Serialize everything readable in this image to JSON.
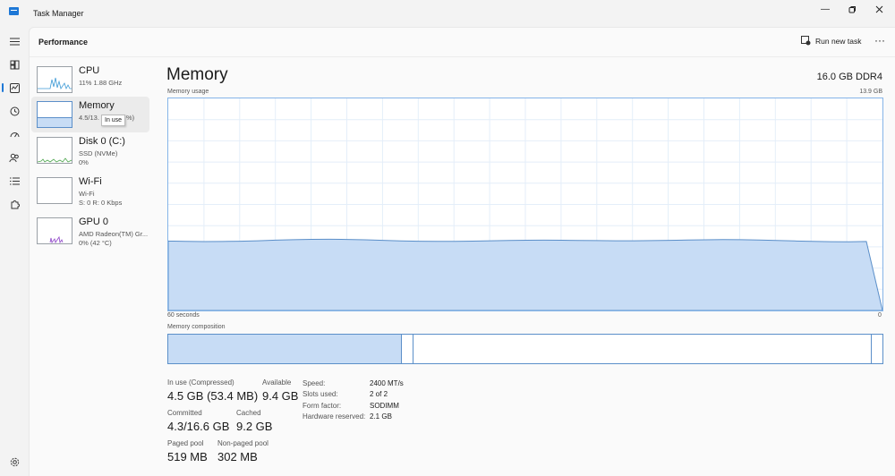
{
  "window": {
    "title": "Task Manager",
    "controls": [
      "minimize-icon",
      "restore-icon",
      "close-icon"
    ]
  },
  "header": {
    "title": "Performance",
    "run_new_task": "Run new task",
    "more": "···"
  },
  "sidebar": [
    {
      "name": "CPU",
      "sub1": "11%  1.88 GHz",
      "sub2": ""
    },
    {
      "name": "Memory",
      "sub1": "4.5/13.",
      "sub1_tail": "%)",
      "sub2": ""
    },
    {
      "name": "Disk 0 (C:)",
      "sub1": "SSD (NVMe)",
      "sub2": "0%"
    },
    {
      "name": "Wi-Fi",
      "sub1": "Wi-Fi",
      "sub2": "S: 0  R: 0 Kbps"
    },
    {
      "name": "GPU 0",
      "sub1": "AMD Radeon(TM) Gr...",
      "sub2": "0%  (42 °C)"
    }
  ],
  "tooltip": "In use",
  "main": {
    "title": "Memory",
    "spec": "16.0 GB DDR4",
    "usage_label": "Memory usage",
    "usage_max": "13.9 GB",
    "time_left": "60 seconds",
    "time_right": "0",
    "usage_level": 0.33,
    "composition_label": "Memory composition",
    "composition": {
      "in_use": 0.326,
      "modified": 0.015,
      "free": 0.015
    }
  },
  "stats": {
    "in_use_label": "In use (Compressed)",
    "in_use_value": "4.5 GB (53.4 MB)",
    "available_label": "Available",
    "available_value": "9.4 GB",
    "committed_label": "Committed",
    "committed_value": "4.3/16.6 GB",
    "cached_label": "Cached",
    "cached_value": "9.2 GB",
    "paged_label": "Paged pool",
    "paged_value": "519 MB",
    "nonpaged_label": "Non-paged pool",
    "nonpaged_value": "302 MB"
  },
  "details": [
    {
      "key": "Speed:",
      "value": "2400 MT/s"
    },
    {
      "key": "Slots used:",
      "value": "2 of 2"
    },
    {
      "key": "Form factor:",
      "value": "SODIMM"
    },
    {
      "key": "Hardware reserved:",
      "value": "2.1 GB"
    }
  ],
  "colors": {
    "accent": "#1e78d6",
    "memory_fill": "#c7dcf5",
    "memory_line": "#5b8fc9",
    "cpu_line": "#3d9ad6",
    "disk_line": "#4ca54c",
    "gpu_line": "#8e44c8"
  }
}
